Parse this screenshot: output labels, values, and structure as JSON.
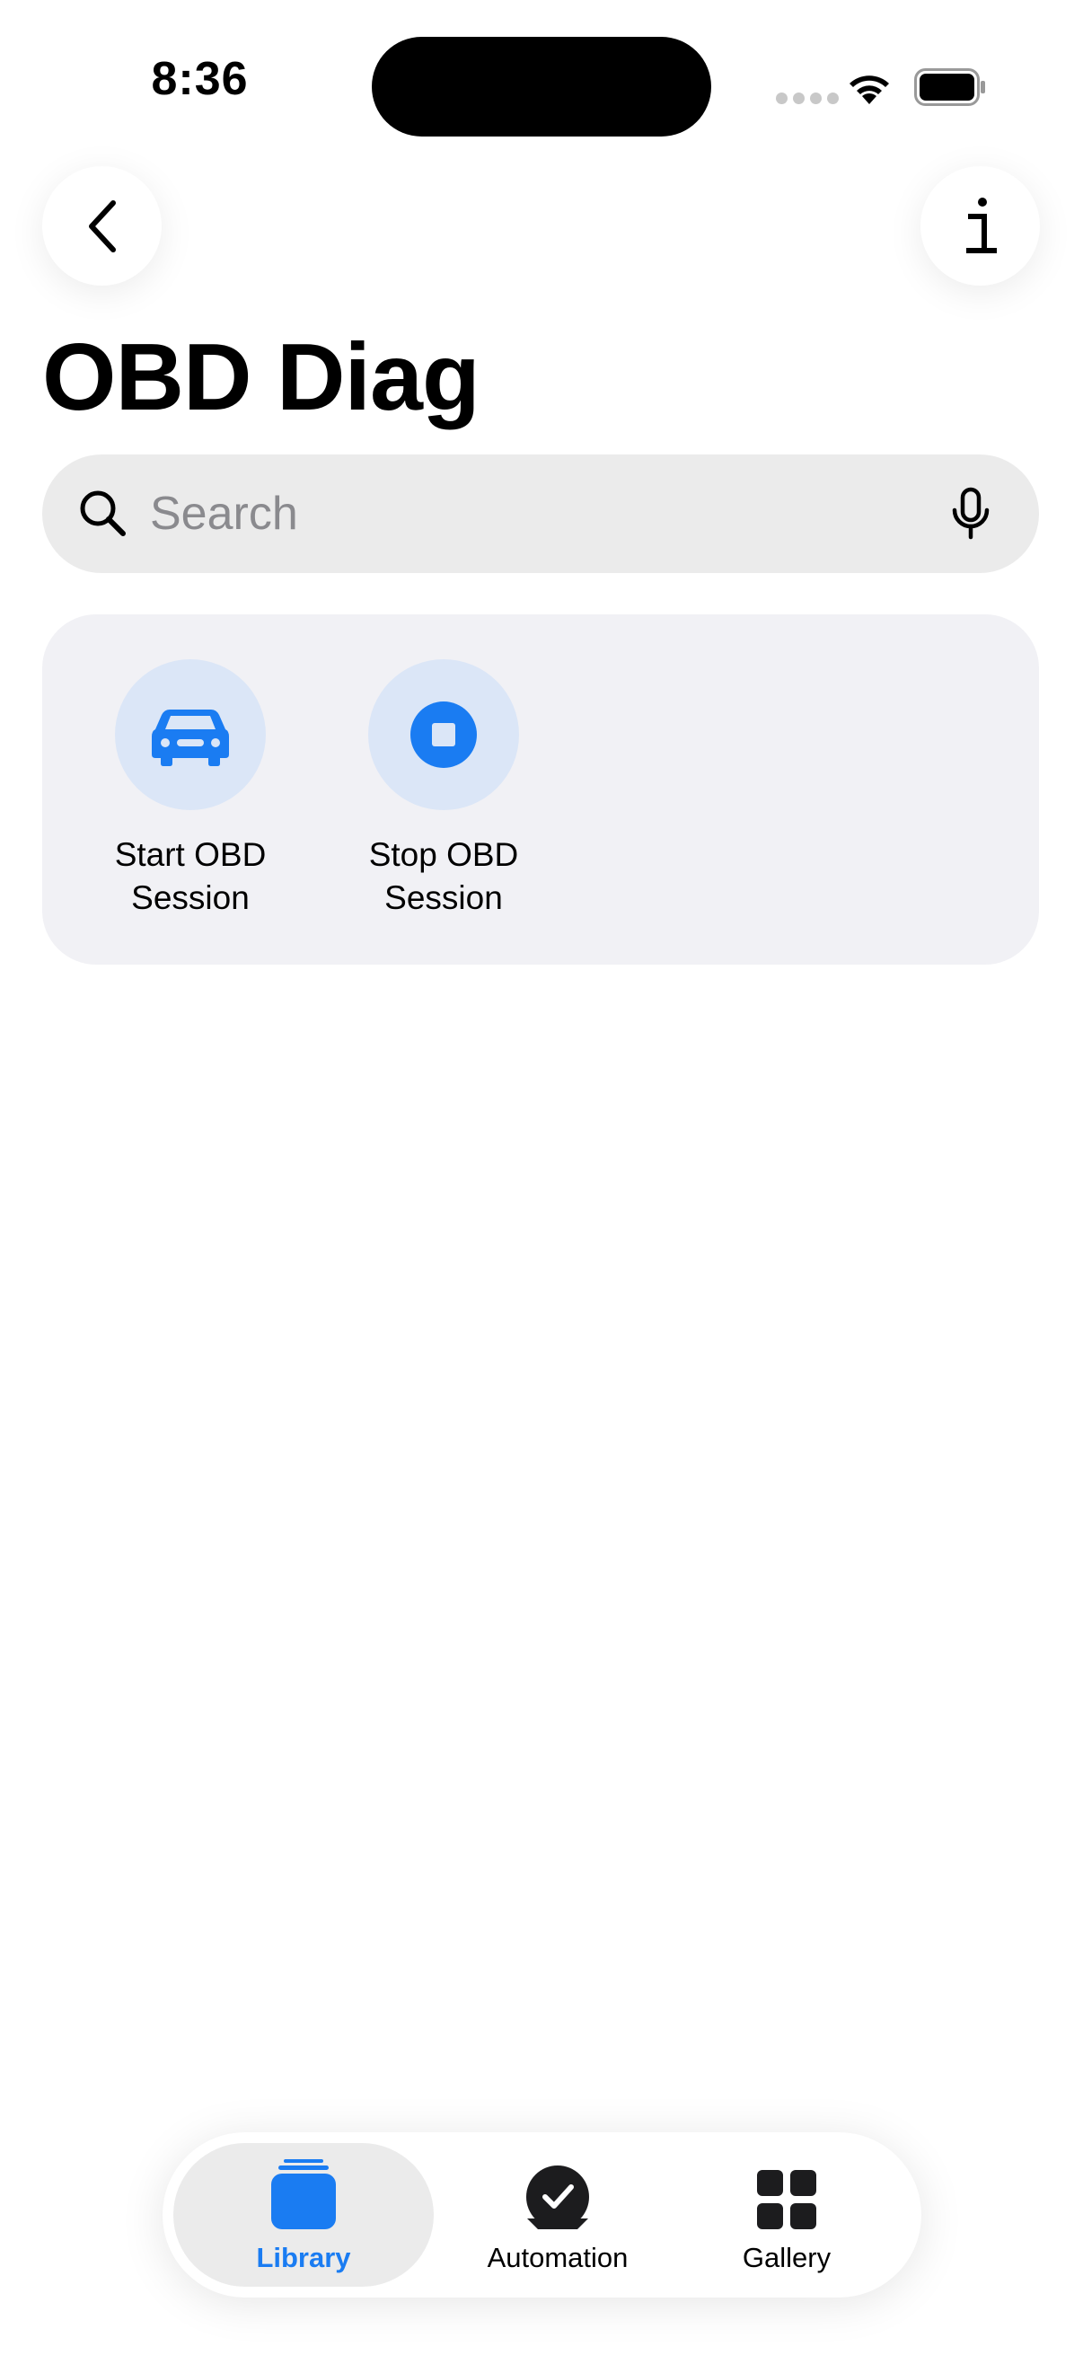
{
  "status_bar": {
    "time": "8:36"
  },
  "nav": {
    "back_icon": "chevron-left-icon",
    "info_icon": "info-icon"
  },
  "page": {
    "title": "OBD Diag"
  },
  "search": {
    "placeholder": "Search",
    "value": ""
  },
  "shortcuts": [
    {
      "label": "Start OBD\nSession",
      "icon": "car-icon"
    },
    {
      "label": "Stop OBD\nSession",
      "icon": "stop-icon"
    }
  ],
  "tab_bar": {
    "items": [
      {
        "label": "Library",
        "icon": "library-stack-icon",
        "selected": true
      },
      {
        "label": "Automation",
        "icon": "automation-check-icon",
        "selected": false
      },
      {
        "label": "Gallery",
        "icon": "gallery-grid-icon",
        "selected": false
      }
    ]
  },
  "colors": {
    "accent": "#1a7cf2",
    "shortcut_bg": "#dbe6f7",
    "panel_bg": "#f1f1f5",
    "search_bg": "#ebebeb"
  }
}
